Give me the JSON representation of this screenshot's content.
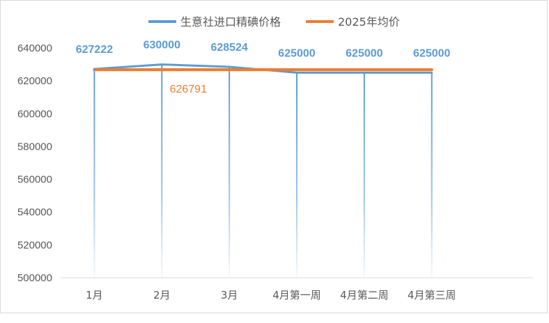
{
  "chart_data": {
    "type": "line",
    "title": "",
    "xlabel": "",
    "ylabel": "",
    "categories": [
      "1月",
      "2月",
      "3月",
      "4月第一周",
      "4月第二周",
      "4月第三周"
    ],
    "ylim": [
      500000,
      640000
    ],
    "yticks": [
      500000,
      520000,
      540000,
      560000,
      580000,
      600000,
      620000,
      640000
    ],
    "grid": false,
    "legend_position": "top",
    "series": [
      {
        "name": "生意社进口精碘价格",
        "color": "#5b9bd5",
        "values": [
          627222,
          630000,
          628524,
          625000,
          625000,
          625000
        ],
        "data_labels": [
          "627222",
          "630000",
          "628524",
          "625000",
          "625000",
          "625000"
        ],
        "drop_lines": true
      },
      {
        "name": "2025年均价",
        "color": "#ed7d31",
        "values": [
          626791,
          626791,
          626791,
          626791,
          626791,
          626791
        ],
        "data_labels": [
          "626791"
        ]
      }
    ]
  }
}
